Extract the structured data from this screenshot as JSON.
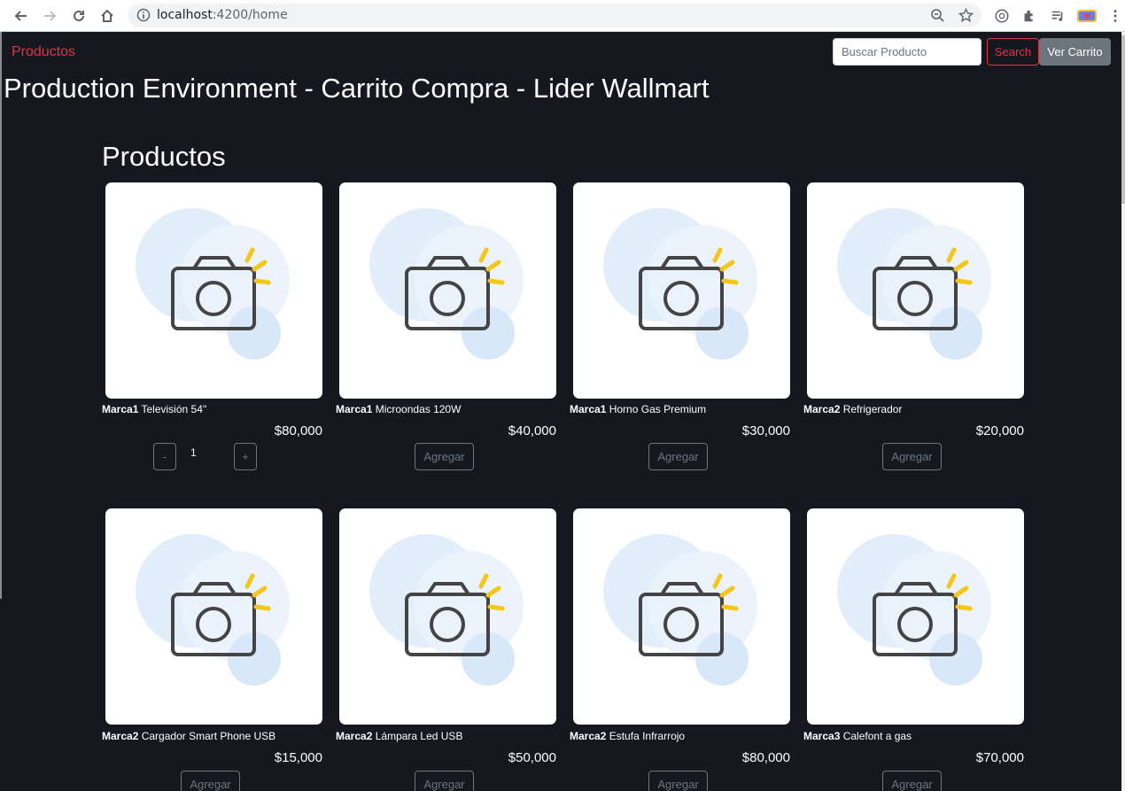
{
  "browser": {
    "url_host": "localhost",
    "url_rest": ":4200/home"
  },
  "navbar": {
    "brand": "Productos",
    "search_placeholder": "Buscar Producto",
    "search_label": "Search",
    "cart_label": "Ver Carrito"
  },
  "page": {
    "env_title": "Production Environment - Carrito Compra - Lider Wallmart",
    "section_title": "Productos"
  },
  "products": [
    {
      "brand": "Marca1",
      "name": "Televisión 54''",
      "price": "$80,000",
      "quantity": "1",
      "minus": "-",
      "plus": "+"
    },
    {
      "brand": "Marca1",
      "name": "Microondas 120W",
      "price": "$40,000",
      "add_label": "Agregar"
    },
    {
      "brand": "Marca1",
      "name": "Horno Gas Premium",
      "price": "$30,000",
      "add_label": "Agregar"
    },
    {
      "brand": "Marca2",
      "name": "Refrigerador",
      "price": "$20,000",
      "add_label": "Agregar"
    },
    {
      "brand": "Marca2",
      "name": "Cargador Smart Phone USB",
      "price": "$15,000",
      "add_label": "Agregar"
    },
    {
      "brand": "Marca2",
      "name": "Lámpara Led USB",
      "price": "$50,000",
      "add_label": "Agregar"
    },
    {
      "brand": "Marca2",
      "name": "Estufa Infrarrojo",
      "price": "$80,000",
      "add_label": "Agregar"
    },
    {
      "brand": "Marca3",
      "name": "Calefont a gas",
      "price": "$70,000",
      "add_label": "Agregar"
    }
  ],
  "colors": {
    "background": "#15181f",
    "danger": "#dc3545",
    "secondary": "#6c757d"
  }
}
